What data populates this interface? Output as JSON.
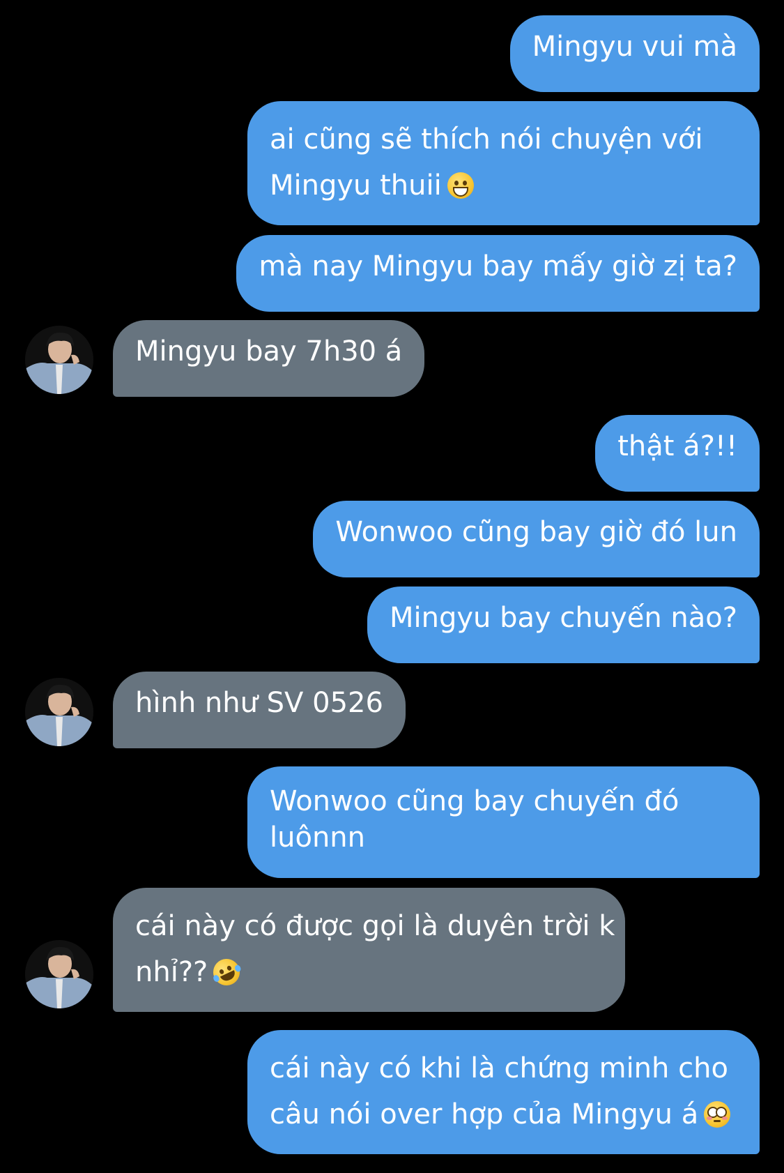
{
  "messages": [
    {
      "direction": "outgoing",
      "text": "Mingyu vui mà"
    },
    {
      "direction": "outgoing",
      "lines": [
        "ai cũng sẽ thích nói chuyện với",
        "Mingyu thuii"
      ],
      "emoji": "grinning-face-emoji"
    },
    {
      "direction": "outgoing",
      "text": "mà nay Mingyu bay mấy giờ zị ta?"
    },
    {
      "direction": "incoming",
      "text": "Mingyu bay 7h30 á",
      "avatar": "contact-avatar"
    },
    {
      "direction": "outgoing",
      "text": "thật á?!!"
    },
    {
      "direction": "outgoing",
      "text": "Wonwoo cũng bay giờ đó lun"
    },
    {
      "direction": "outgoing",
      "text": "Mingyu bay chuyến nào?"
    },
    {
      "direction": "incoming",
      "text": "hình như SV 0526",
      "avatar": "contact-avatar"
    },
    {
      "direction": "outgoing",
      "lines": [
        "Wonwoo cũng bay chuyến đó",
        "luônnn"
      ]
    },
    {
      "direction": "incoming",
      "lines": [
        "cái này có được gọi là duyên trời k",
        "nhỉ??"
      ],
      "emoji": "rolling-laughing-emoji",
      "avatar": "contact-avatar"
    },
    {
      "direction": "outgoing",
      "lines": [
        "cái này có khi là chứng minh cho",
        "câu nói over hợp của Mingyu á"
      ],
      "emoji": "flushed-face-emoji"
    }
  ],
  "colors": {
    "background": "#000000",
    "outgoing_bubble": "#4d9be8",
    "incoming_bubble": "#67747f",
    "text": "#ffffff"
  }
}
